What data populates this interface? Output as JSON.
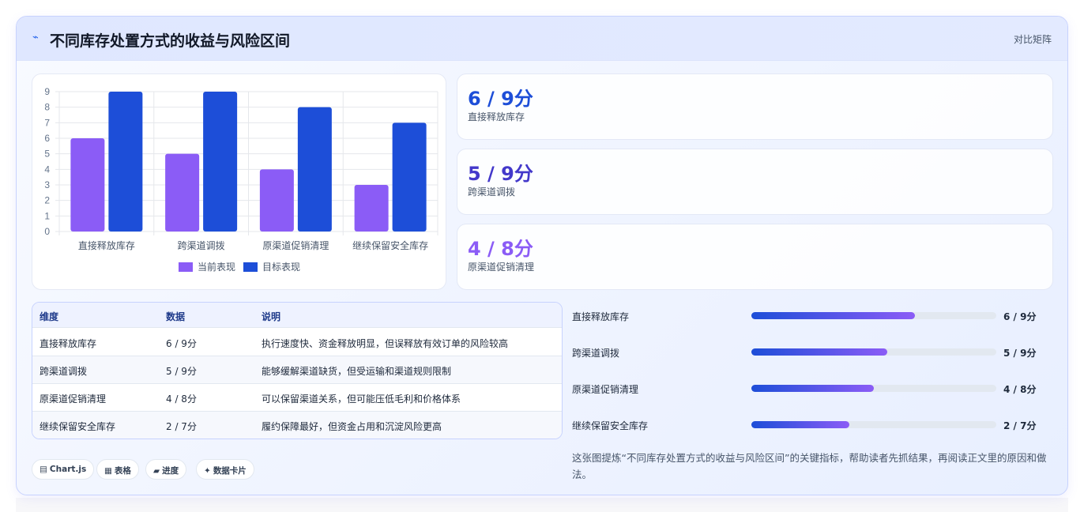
{
  "header": {
    "icon": "pulse-icon",
    "title": "不同库存处置方式的收益与风险区间",
    "tag": "对比矩阵"
  },
  "chart_data": {
    "type": "bar",
    "categories": [
      "直接释放库存",
      "跨渠道调拨",
      "原渠道促销清理",
      "继续保留安全库存"
    ],
    "series": [
      {
        "name": "当前表现",
        "values": [
          6,
          5,
          4,
          3
        ],
        "color": "#8b5cf6"
      },
      {
        "name": "目标表现",
        "values": [
          9,
          9,
          8,
          7
        ],
        "color": "#1d4ed8"
      }
    ],
    "ylim": [
      0,
      9
    ],
    "yticks": [
      "0",
      "1",
      "2",
      "3",
      "4",
      "5",
      "6",
      "7",
      "8",
      "9"
    ],
    "grid": true,
    "legend": "bottom"
  },
  "stats": [
    {
      "value": "6 / 9分",
      "label": "直接释放库存",
      "color": "#1d4ed8"
    },
    {
      "value": "5 / 9分",
      "label": "跨渠道调拨",
      "color": "#4338ca"
    },
    {
      "value": "4 / 8分",
      "label": "原渠道促销清理",
      "color": "#8b5cf6"
    }
  ],
  "table": {
    "headers": [
      "维度",
      "数据",
      "说明"
    ],
    "rows": [
      [
        "直接释放库存",
        "6 / 9分",
        "执行速度快、资金释放明显，但误释放有效订单的风险较高"
      ],
      [
        "跨渠道调拨",
        "5 / 9分",
        "能够缓解渠道缺货，但受运输和渠道规则限制"
      ],
      [
        "原渠道促销清理",
        "4 / 8分",
        "可以保留渠道关系，但可能压低毛利和价格体系"
      ],
      [
        "继续保留安全库存",
        "2 / 7分",
        "履约保障最好，但资金占用和沉淀风险更高"
      ]
    ]
  },
  "progress": [
    {
      "label": "直接释放库存",
      "value": "6 / 9分",
      "fraction": 0.667
    },
    {
      "label": "跨渠道调拨",
      "value": "5 / 9分",
      "fraction": 0.556
    },
    {
      "label": "原渠道促销清理",
      "value": "4 / 8分",
      "fraction": 0.5
    },
    {
      "label": "继续保留安全库存",
      "value": "2 / 7分",
      "fraction": 0.4
    }
  ],
  "description": "这张图提炼“不同库存处置方式的收益与风险区间”的关键指标，帮助读者先抓结果，再阅读正文里的原因和做法。",
  "chips": [
    {
      "icon": "▤",
      "label": "Chart.js"
    },
    {
      "icon": "▦",
      "label": "表格"
    },
    {
      "icon": "▰",
      "label": "进度"
    },
    {
      "icon": "✦",
      "label": "数据卡片"
    }
  ]
}
